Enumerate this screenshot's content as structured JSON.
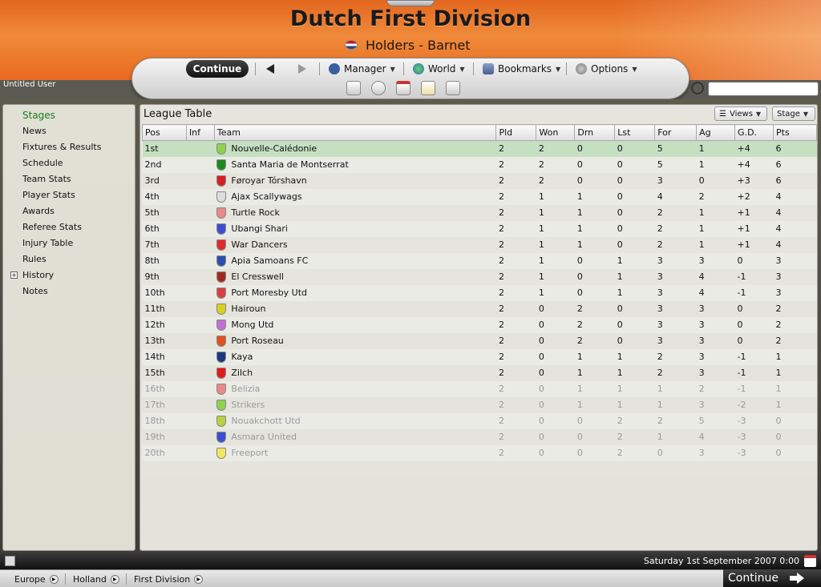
{
  "header": {
    "title": "Dutch First Division",
    "holders": "Holders - Barnet",
    "user": "Untitled User"
  },
  "nav": {
    "continue_label": "Continue",
    "manager_label": "Manager",
    "world_label": "World",
    "bookmarks_label": "Bookmarks",
    "options_label": "Options"
  },
  "search": {
    "value": ""
  },
  "sidebar": {
    "items": [
      {
        "label": "Stages"
      },
      {
        "label": "News"
      },
      {
        "label": "Fixtures & Results"
      },
      {
        "label": "Schedule"
      },
      {
        "label": "Team Stats"
      },
      {
        "label": "Player Stats"
      },
      {
        "label": "Awards"
      },
      {
        "label": "Referee Stats"
      },
      {
        "label": "Injury Table"
      },
      {
        "label": "Rules"
      },
      {
        "label": "History"
      },
      {
        "label": "Notes"
      }
    ]
  },
  "panel": {
    "title": "League Table",
    "views_label": "Views",
    "stage_label": "Stage"
  },
  "table": {
    "headers": [
      "Pos",
      "Inf",
      "Team",
      "Pld",
      "Won",
      "Drn",
      "Lst",
      "For",
      "Ag",
      "G.D.",
      "Pts"
    ],
    "rows": [
      {
        "pos": "1st",
        "team": "Nouvelle-Calédonie",
        "pld": "2",
        "won": "2",
        "drn": "0",
        "lst": "0",
        "for": "5",
        "ag": "1",
        "gd": "+4",
        "pts": "6",
        "kit": "#8fd14f"
      },
      {
        "pos": "2nd",
        "team": "Santa Maria de Montserrat",
        "pld": "2",
        "won": "2",
        "drn": "0",
        "lst": "0",
        "for": "5",
        "ag": "1",
        "gd": "+4",
        "pts": "6",
        "kit": "#1a8a1a"
      },
      {
        "pos": "3rd",
        "team": "Føroyar Tórshavn",
        "pld": "2",
        "won": "2",
        "drn": "0",
        "lst": "0",
        "for": "3",
        "ag": "0",
        "gd": "+3",
        "pts": "6",
        "kit": "#d42020"
      },
      {
        "pos": "4th",
        "team": "Ajax Scallywags",
        "pld": "2",
        "won": "1",
        "drn": "1",
        "lst": "0",
        "for": "4",
        "ag": "2",
        "gd": "+2",
        "pts": "4",
        "kit": "#dddddd"
      },
      {
        "pos": "5th",
        "team": "Turtle Rock",
        "pld": "2",
        "won": "1",
        "drn": "1",
        "lst": "0",
        "for": "2",
        "ag": "1",
        "gd": "+1",
        "pts": "4",
        "kit": "#e88a8a"
      },
      {
        "pos": "6th",
        "team": "Ubangi Shari",
        "pld": "2",
        "won": "1",
        "drn": "1",
        "lst": "0",
        "for": "2",
        "ag": "1",
        "gd": "+1",
        "pts": "4",
        "kit": "#3a4fd0"
      },
      {
        "pos": "7th",
        "team": "War Dancers",
        "pld": "2",
        "won": "1",
        "drn": "1",
        "lst": "0",
        "for": "2",
        "ag": "1",
        "gd": "+1",
        "pts": "4",
        "kit": "#e02a2a"
      },
      {
        "pos": "8th",
        "team": "Apia Samoans FC",
        "pld": "2",
        "won": "1",
        "drn": "0",
        "lst": "1",
        "for": "3",
        "ag": "3",
        "gd": "0",
        "pts": "3",
        "kit": "#2a4fb0"
      },
      {
        "pos": "9th",
        "team": "El Cresswell",
        "pld": "2",
        "won": "1",
        "drn": "0",
        "lst": "1",
        "for": "3",
        "ag": "4",
        "gd": "-1",
        "pts": "3",
        "kit": "#a02a1a"
      },
      {
        "pos": "10th",
        "team": "Port Moresby Utd",
        "pld": "2",
        "won": "1",
        "drn": "0",
        "lst": "1",
        "for": "3",
        "ag": "4",
        "gd": "-1",
        "pts": "3",
        "kit": "#d84040"
      },
      {
        "pos": "11th",
        "team": "Hairoun",
        "pld": "2",
        "won": "0",
        "drn": "2",
        "lst": "0",
        "for": "3",
        "ag": "3",
        "gd": "0",
        "pts": "2",
        "kit": "#d8d020"
      },
      {
        "pos": "12th",
        "team": "Mong Utd",
        "pld": "2",
        "won": "0",
        "drn": "2",
        "lst": "0",
        "for": "3",
        "ag": "3",
        "gd": "0",
        "pts": "2",
        "kit": "#c070d0"
      },
      {
        "pos": "13th",
        "team": "Port Roseau",
        "pld": "2",
        "won": "0",
        "drn": "2",
        "lst": "0",
        "for": "3",
        "ag": "3",
        "gd": "0",
        "pts": "2",
        "kit": "#e05020"
      },
      {
        "pos": "14th",
        "team": "Kaya",
        "pld": "2",
        "won": "0",
        "drn": "1",
        "lst": "1",
        "for": "2",
        "ag": "3",
        "gd": "-1",
        "pts": "1",
        "kit": "#1a3a80"
      },
      {
        "pos": "15th",
        "team": "Zilch",
        "pld": "2",
        "won": "0",
        "drn": "1",
        "lst": "1",
        "for": "2",
        "ag": "3",
        "gd": "-1",
        "pts": "1",
        "kit": "#e01a1a"
      },
      {
        "pos": "16th",
        "team": "Belizia",
        "pld": "2",
        "won": "0",
        "drn": "1",
        "lst": "1",
        "for": "1",
        "ag": "2",
        "gd": "-1",
        "pts": "1",
        "kit": "#e88a8a",
        "faded": true
      },
      {
        "pos": "17th",
        "team": "Strikers",
        "pld": "2",
        "won": "0",
        "drn": "1",
        "lst": "1",
        "for": "1",
        "ag": "3",
        "gd": "-2",
        "pts": "1",
        "kit": "#8fd14f",
        "faded": true
      },
      {
        "pos": "18th",
        "team": "Nouakchott Utd",
        "pld": "2",
        "won": "0",
        "drn": "0",
        "lst": "2",
        "for": "2",
        "ag": "5",
        "gd": "-3",
        "pts": "0",
        "kit": "#b8d040",
        "faded": true
      },
      {
        "pos": "19th",
        "team": "Asmara United",
        "pld": "2",
        "won": "0",
        "drn": "0",
        "lst": "2",
        "for": "1",
        "ag": "4",
        "gd": "-3",
        "pts": "0",
        "kit": "#3a4fd0",
        "faded": true
      },
      {
        "pos": "20th",
        "team": "Freeport",
        "pld": "2",
        "won": "0",
        "drn": "0",
        "lst": "2",
        "for": "0",
        "ag": "3",
        "gd": "-3",
        "pts": "0",
        "kit": "#f0e860",
        "faded": true
      }
    ]
  },
  "status": {
    "datetime": "Saturday 1st September 2007 0:00"
  },
  "breadcrumbs": [
    "Europe",
    "Holland",
    "First Division"
  ],
  "continue_bottom": "Continue"
}
